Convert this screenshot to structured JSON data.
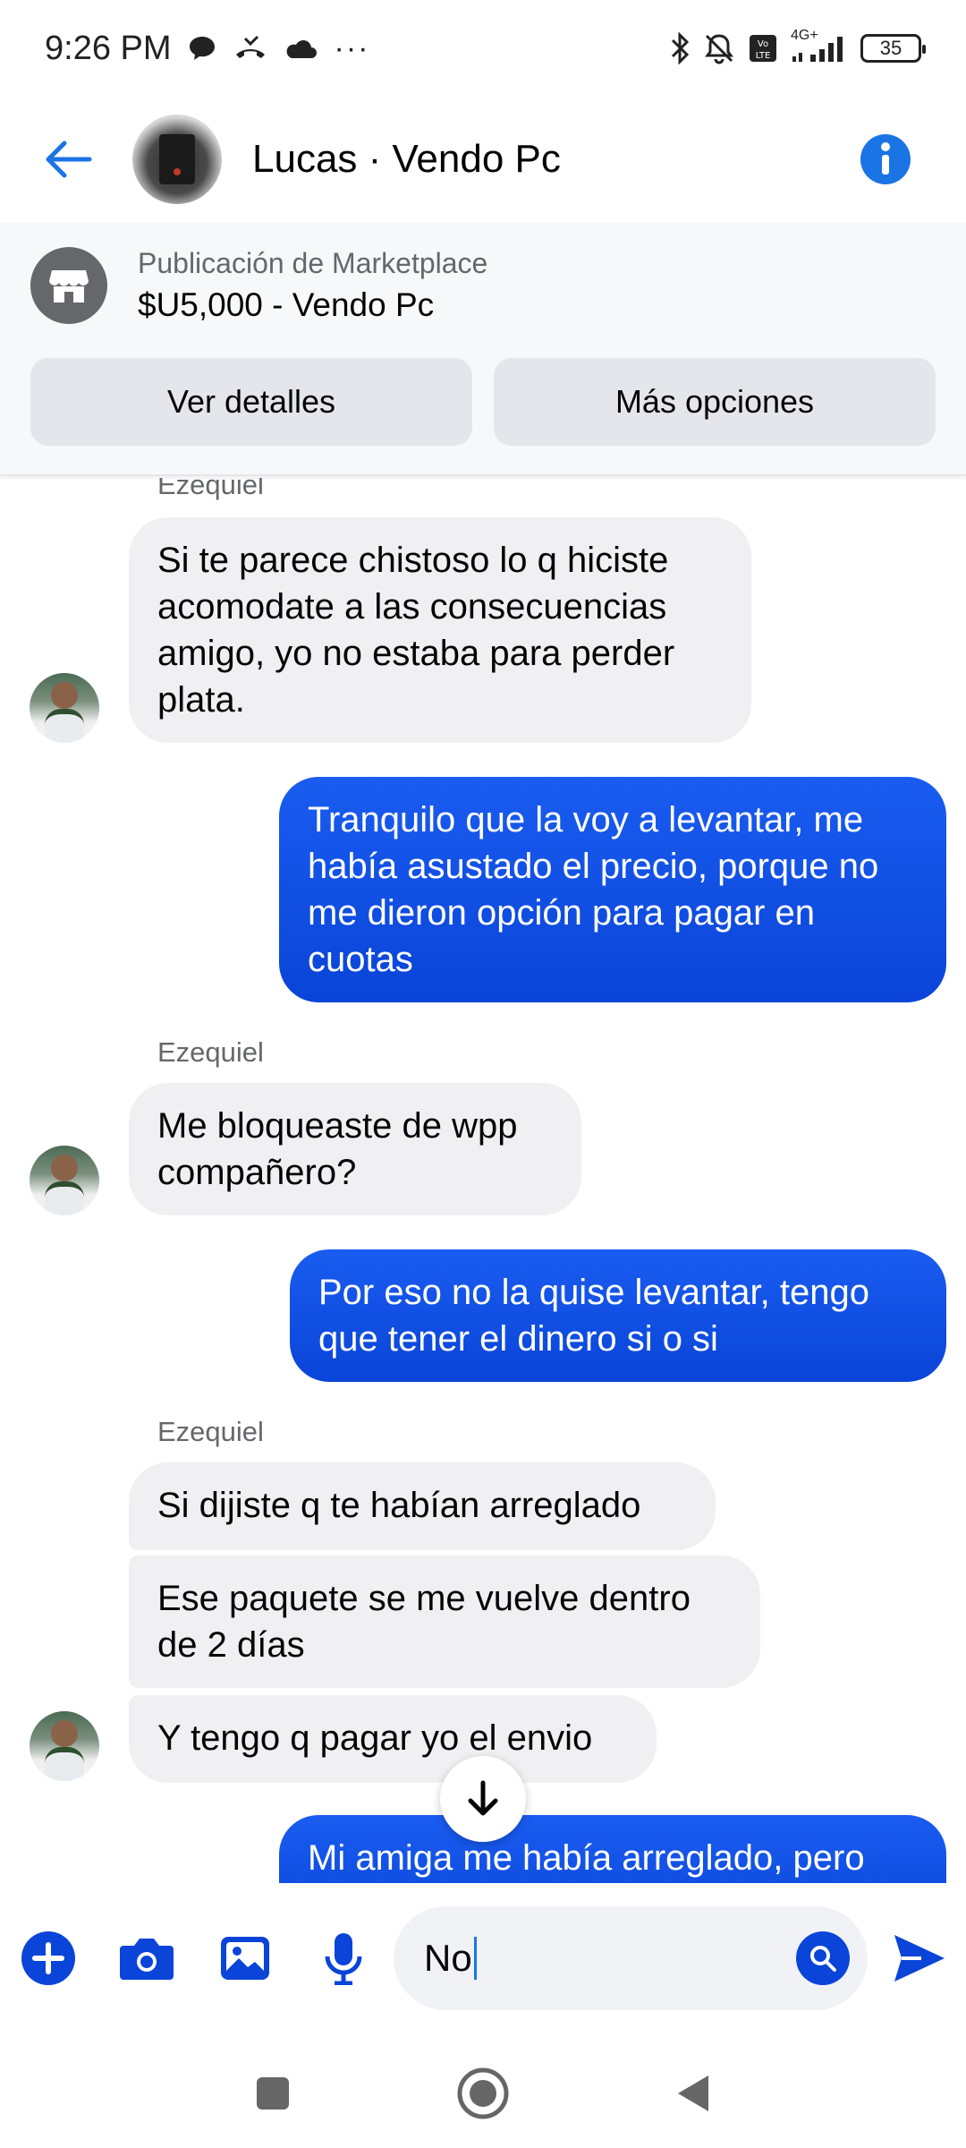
{
  "status_bar": {
    "time": "9:26 PM",
    "more": "···",
    "battery": "35",
    "network": "4G+"
  },
  "header": {
    "title": "Lucas · Vendo Pc"
  },
  "marketplace": {
    "label": "Publicación de Marketplace",
    "title": "$U5,000 - Vendo Pc",
    "details_button": "Ver detalles",
    "options_button": "Más opciones"
  },
  "messages": [
    {
      "sender": "Ezequiel",
      "direction": "in",
      "text": "Si te parece chistoso lo q hiciste acomodate a las consecuencias amigo, yo no estaba para perder plata."
    },
    {
      "direction": "out",
      "text": "Tranquilo que la voy a levantar, me había asustado el precio, porque no me dieron opción para pagar en cuotas"
    },
    {
      "sender": "Ezequiel",
      "direction": "in",
      "text": "Me bloqueaste de wpp compañero?"
    },
    {
      "direction": "out",
      "text": "Por eso no la quise levantar, tengo que tener el dinero si o si"
    },
    {
      "sender": "Ezequiel",
      "direction": "in",
      "text": "Si dijiste q te habían arreglado"
    },
    {
      "direction": "in",
      "text": "Ese paquete se me vuelve dentro de 2 días"
    },
    {
      "direction": "in",
      "text": "Y tengo q pagar yo el envio"
    },
    {
      "direction": "out",
      "text": "Mi amiga me había arreglado, pero"
    }
  ],
  "composer": {
    "value": "No"
  },
  "colors": {
    "accent": "#0a44d8",
    "link": "#1b74e4",
    "incoming_bubble": "#f0f0f2"
  }
}
